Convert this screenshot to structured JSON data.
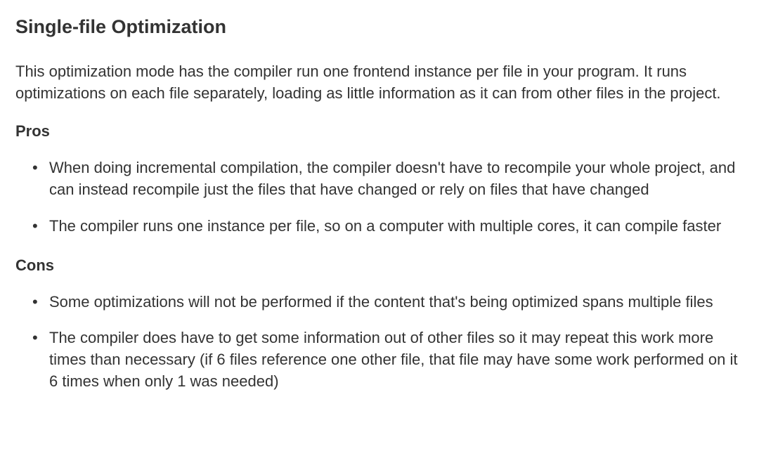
{
  "section": {
    "title": "Single-file Optimization",
    "intro": "This optimization mode has the compiler run one frontend instance per file in your program. It runs optimizations on each file separately, loading as little information as it can from other files in the project.",
    "pros": {
      "heading": "Pros",
      "items": [
        "When doing incremental compilation, the compiler doesn't have to recompile your whole project, and can instead recompile just the files that have changed or rely on files that have changed",
        "The compiler runs one instance per file, so on a computer with multiple cores, it can compile faster"
      ]
    },
    "cons": {
      "heading": "Cons",
      "items": [
        "Some optimizations will not be performed if the content that's being optimized spans multiple files",
        "The compiler does have to get some information out of other files so it may repeat this work more times than necessary (if 6 files reference one other file, that file may have some work performed on it 6 times when only 1 was needed)"
      ]
    }
  }
}
